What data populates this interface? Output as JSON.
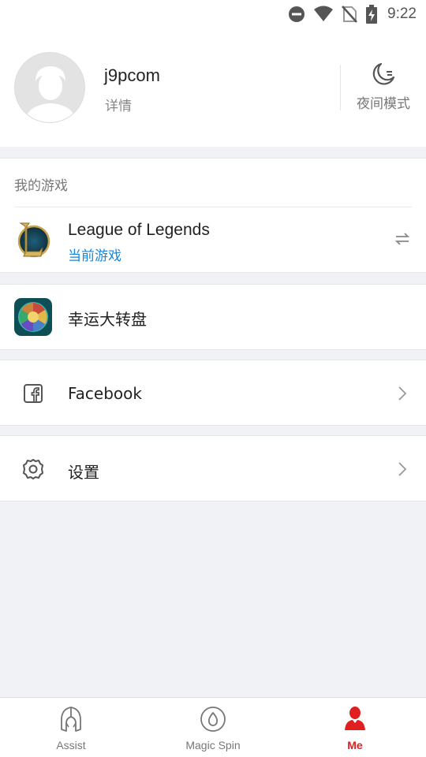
{
  "status_bar": {
    "time": "9:22",
    "icons": [
      "do-not-disturb-icon",
      "wifi-icon",
      "no-sim-icon",
      "battery-charging-icon"
    ]
  },
  "profile": {
    "username": "j9pcom",
    "details_label": "详情",
    "night_mode_label": "夜间模式"
  },
  "my_games": {
    "title": "我的游戏",
    "game": {
      "name": "League of Legends",
      "status": "当前游戏",
      "icon": "league-of-legends-icon"
    },
    "switch_icon": "switch-arrows-icon"
  },
  "menu": {
    "lucky_wheel": {
      "label": "幸运大转盘",
      "icon": "lucky-wheel-icon"
    },
    "facebook": {
      "label": "Facebook",
      "icon": "facebook-icon"
    },
    "settings": {
      "label": "设置",
      "icon": "gear-icon"
    }
  },
  "tabs": [
    {
      "label": "Assist",
      "icon": "helmet-icon",
      "active": false
    },
    {
      "label": "Magic Spin",
      "icon": "spin-icon",
      "active": false
    },
    {
      "label": "Me",
      "icon": "person-icon",
      "active": true
    }
  ],
  "colors": {
    "accent": "#e02020",
    "link_blue": "#1a86d8",
    "background": "#f1f2f5"
  }
}
